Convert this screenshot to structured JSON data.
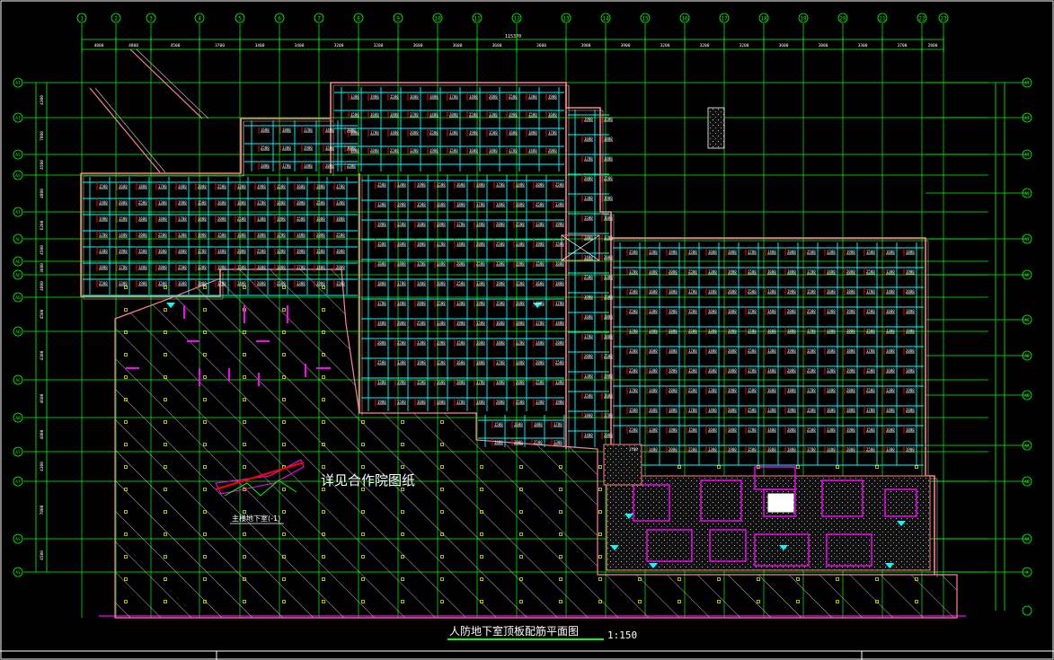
{
  "drawing": {
    "title": "人防地下室顶板配筋平面图",
    "scale": "1:150",
    "note": "详见合作院图纸",
    "detail_label": "主楼地下室(-1)",
    "total_dimension": "115370"
  },
  "axes": {
    "columns": [
      "1",
      "2",
      "3",
      "4",
      "5",
      "6",
      "7",
      "8",
      "9",
      "10",
      "11",
      "12",
      "13",
      "14",
      "15",
      "16",
      "17",
      "18",
      "19",
      "20",
      "21",
      "22",
      "23"
    ],
    "column_spacings": [
      "4800",
      "4800",
      "4500",
      "3700",
      "3400",
      "3400",
      "3200",
      "3200",
      "3600",
      "3600",
      "3600",
      "3600",
      "3900",
      "3900",
      "3200",
      "3200",
      "3200",
      "3600",
      "3800",
      "3300",
      "3700",
      "2800"
    ],
    "rows_left": [
      "AT",
      "AT",
      "AS",
      "AS",
      "AT",
      "AL",
      "AE",
      "AF",
      "AD",
      "AD",
      "AC",
      "AB"
    ],
    "rows_right": [
      "AT",
      "AT",
      "AT",
      "AS",
      "AT",
      "AP",
      "AC",
      "AD",
      "AD",
      "AA",
      "AB",
      "AA",
      "A"
    ],
    "row_spacings_left": [
      "4300",
      "7800",
      "4500",
      "4800",
      "6200",
      "4500",
      "3600",
      "4800",
      "4500",
      "4300",
      "4600",
      "4800"
    ]
  },
  "rebar_labels": [
    "1500",
    "1600",
    "1800",
    "1700",
    "1400",
    "2000",
    "2500",
    "1300",
    "1900"
  ],
  "colors": {
    "background": "#000000",
    "axis": "#00ff00",
    "wall": "#ff7f7f",
    "rebar": "#00ffff",
    "marker": "#ff0000",
    "label": "#ffffff",
    "hatch": "#c0c0c0",
    "column": "#ffff00",
    "magenta": "#ff00ff"
  }
}
